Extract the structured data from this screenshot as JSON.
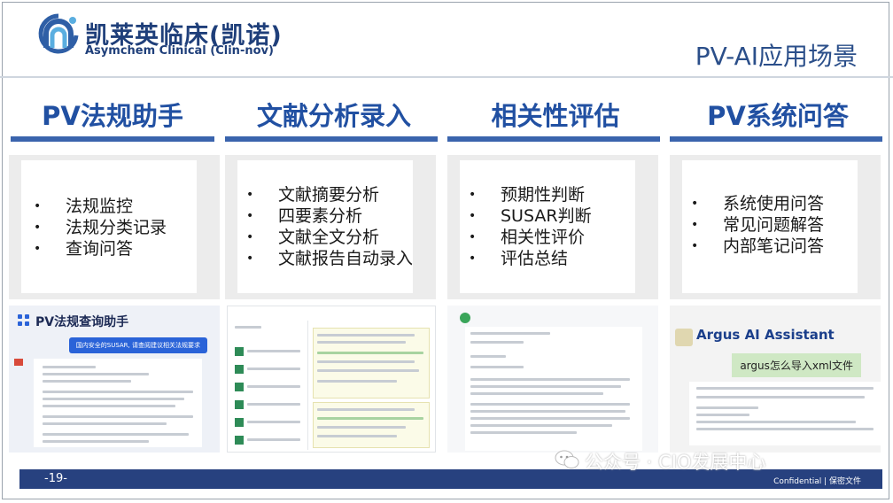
{
  "header": {
    "brand_cn": "凯莱英临床(凯诺)",
    "brand_en": "Asymchem Clinical (Clin-nov)",
    "title": "PV-AI应用场景"
  },
  "columns": [
    {
      "title": "PV法规助手",
      "items": [
        "法规监控",
        "法规分类记录",
        "查询问答"
      ]
    },
    {
      "title": "文献分析录入",
      "items": [
        "文献摘要分析",
        "四要素分析",
        "文献全文分析",
        "文献报告自动录入"
      ]
    },
    {
      "title": "相关性评估",
      "items": [
        "预期性判断",
        "SUSAR判断",
        "相关性评价",
        "评估总结"
      ]
    },
    {
      "title": "PV系统问答",
      "items": [
        "系统使用问答",
        "常见问题解答",
        "内部笔记问答"
      ]
    }
  ],
  "screenshots": {
    "regulation_assistant": {
      "title": "PV法规查询助手",
      "bubble": "国内安全的SUSAR, 请查阅建议相关法规要求"
    },
    "argus": {
      "title": "Argus AI Assistant",
      "question": "argus怎么导入xml文件"
    }
  },
  "footer": {
    "page": "-19-",
    "watermark": "公众号 · CIO发展中心",
    "confidential": "Confidential | 保密文件"
  },
  "colors": {
    "accent": "#2150a2",
    "bar": "#3a64ad",
    "footer": "#27417f"
  }
}
